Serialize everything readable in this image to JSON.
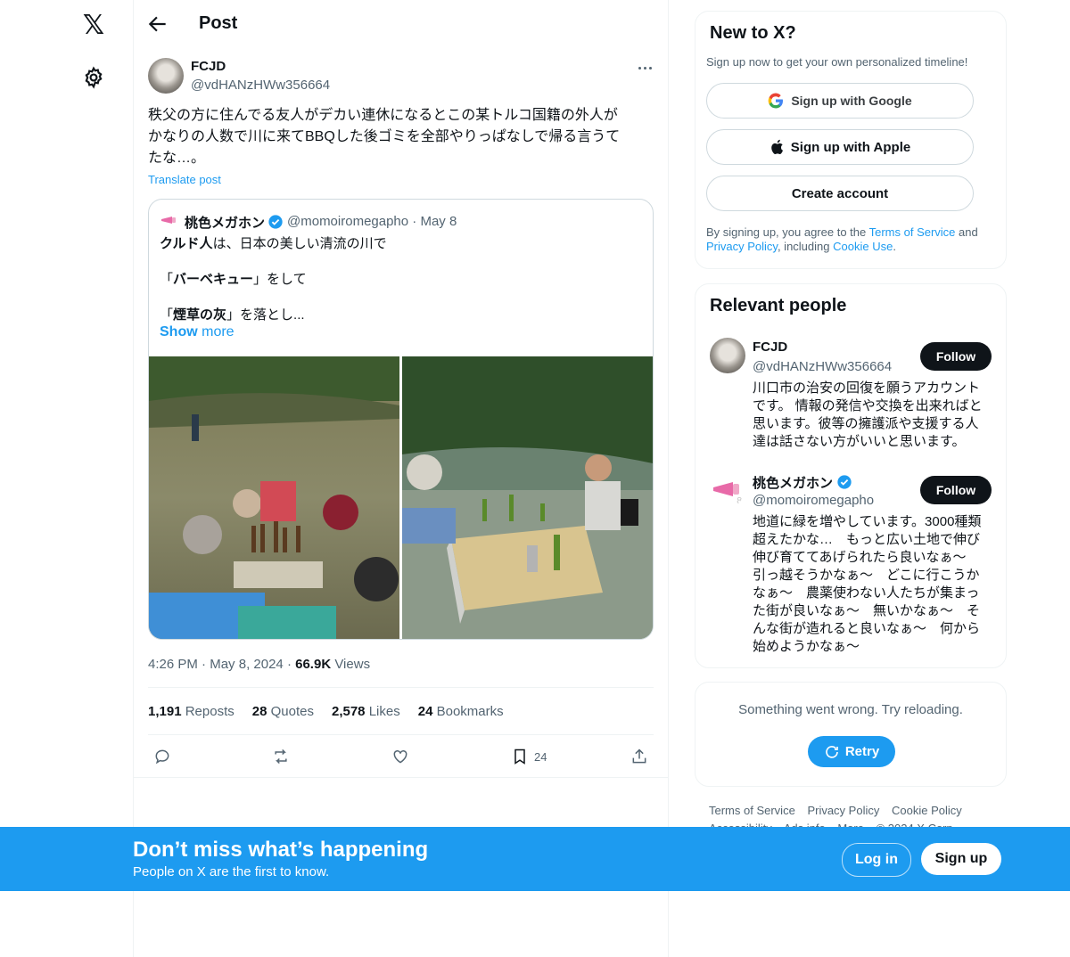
{
  "colors": {
    "accent": "#1d9bf0",
    "text": "#0f1419",
    "muted": "#536471",
    "border": "#cfd9de"
  },
  "nav": {
    "logo_icon": "x-logo-icon",
    "settings_icon": "gear-icon"
  },
  "header": {
    "title": "Post"
  },
  "post": {
    "author_name": "FCJD",
    "author_handle": "@vdHANzHWw356664",
    "text": "秩父の方に住んでる友人がデカい連休になるとこの某トルコ国籍の外人が\nかなりの人数で川に来てBBQした後ゴミを全部やりっぱなしで帰る言うて\nたな…。",
    "translate": "Translate post",
    "quote": {
      "author_name": "桃色メガホン",
      "author_handle": "@momoiromegapho",
      "dot": "·",
      "date": "May 8",
      "line1_bold": "クルド人",
      "line1_rest": "は、日本の美しい清流の川で",
      "line2_open": "「",
      "line2_bold": "バーベキュー",
      "line2_rest": "」をして",
      "line3_open": "「",
      "line3_bold": "煙草の灰",
      "line3_rest": "」を落とし...",
      "show_more_a": "Show",
      "show_more_b": " more"
    },
    "time": "4:26 PM",
    "sep": "·",
    "date": "May 8, 2024",
    "views_count": "66.9K",
    "views_label": "Views",
    "stats": {
      "reposts_count": "1,191",
      "reposts_label": "Reposts",
      "quotes_count": "28",
      "quotes_label": "Quotes",
      "likes_count": "2,578",
      "likes_label": "Likes",
      "bookmarks_count": "24",
      "bookmarks_label": "Bookmarks"
    },
    "actions": {
      "bookmark_count": "24"
    }
  },
  "sidebar": {
    "new_card": {
      "title": "New to X?",
      "subtitle": "Sign up now to get your own personalized timeline!",
      "google": "Sign up with Google",
      "apple": "Sign up with Apple",
      "create": "Create account",
      "legal_1": "By signing up, you agree to the ",
      "terms": "Terms of Service",
      "legal_2": " and ",
      "privacy": "Privacy Policy",
      "legal_3": ", including ",
      "cookie": "Cookie Use",
      "legal_4": "."
    },
    "people": {
      "title": "Relevant people",
      "items": [
        {
          "name": "FCJD",
          "handle": "@vdHANzHWw356664",
          "follow": "Follow",
          "bio": "川口市の治安の回復を願うアカウントです。 情報の発信や交換を出来ればと思います。彼等の擁護派や支援する人達は話さない方がいいと思います。"
        },
        {
          "name": "桃色メガホン",
          "handle": "@momoiromegapho",
          "follow": "Follow",
          "bio": "地道に緑を増やしています。3000種類超えたかな…　もっと広い土地で伸び伸び育ててあげられたら良いなぁ〜　引っ越そうかなぁ〜　どこに行こうかなぁ〜　農薬使わない人たちが集まった街が良いなぁ〜　無いかなぁ〜　そんな街が造れると良いなぁ〜　何から始めようかなぁ〜"
        }
      ]
    },
    "error": {
      "text": "Something went wrong. Try reloading.",
      "retry": "Retry"
    },
    "footer": [
      "Terms of Service",
      "Privacy Policy",
      "Cookie Policy",
      "Accessibility",
      "Ads info",
      "More",
      "© 2024 X Corp."
    ]
  },
  "bottom_bar": {
    "title": "Don’t miss what’s happening",
    "subtitle": "People on X are the first to know.",
    "login": "Log in",
    "signup": "Sign up"
  }
}
